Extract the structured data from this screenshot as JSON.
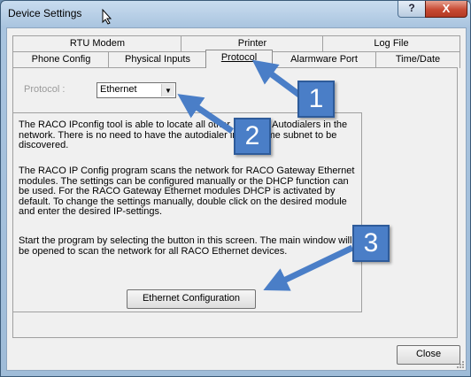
{
  "window": {
    "title": "Device Settings",
    "help_glyph": "?",
    "close_glyph": "X"
  },
  "tabs": {
    "row_back": [
      "RTU Modem",
      "Printer",
      "Log File"
    ],
    "row_front": [
      "Phone Config",
      "Physical Inputs",
      "Protocol",
      "Alarmware Port",
      "Time/Date"
    ],
    "active": "Protocol"
  },
  "protocol": {
    "label": "Protocol :",
    "selected": "Ethernet"
  },
  "description": {
    "p1": "The RACO IPconfig tool is able to locate all other Ethernet Autodialers in the network.  There is no need to have the autodialer in the same subnet to be discovered.",
    "p2": "The RACO IP Config program scans the network for RACO Gateway Ethernet modules. The settings can be configured manually or the DHCP function can be used. For the RACO Gateway Ethernet modules DHCP is activated by default. To change the settings manually, double click on the desired module and enter the desired IP-settings.",
    "p3": "Start the program by selecting the button in this screen.  The main window will be opened to scan the network for all RACO Ethernet devices."
  },
  "buttons": {
    "ethernet_config": "Ethernet Configuration",
    "close": "Close"
  },
  "callouts": [
    "1",
    "2",
    "3"
  ],
  "colors": {
    "callout_fill": "#4a7ec7",
    "arrow": "#4a7ec7",
    "close_red": "#c74a33"
  }
}
